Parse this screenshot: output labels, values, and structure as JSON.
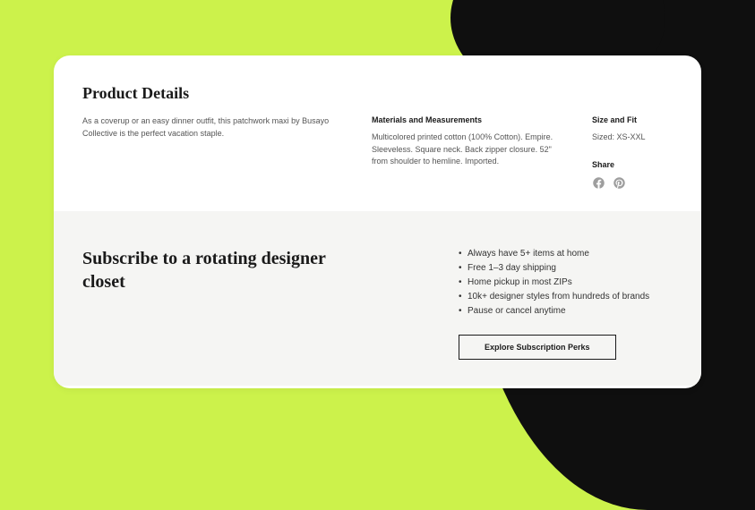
{
  "productDetails": {
    "heading": "Product Details",
    "description": "As a coverup or an easy dinner outfit, this patchwork maxi by Busayo Collective is the perfect vacation staple.",
    "materials": {
      "heading": "Materials and Measurements",
      "text": "Multicolored printed cotton (100% Cotton). Empire. Sleeveless. Square neck. Back zipper closure. 52\" from shoulder to hemline. Imported."
    },
    "sizeFit": {
      "heading": "Size and Fit",
      "text": "Sized: XS-XXL"
    },
    "share": {
      "heading": "Share"
    }
  },
  "subscribe": {
    "heading": "Subscribe to a rotating designer closet",
    "perks": [
      "Always have 5+ items at home",
      "Free 1–3 day shipping",
      "Home pickup in most ZIPs",
      "10k+ designer styles from hundreds of brands",
      "Pause or cancel anytime"
    ],
    "cta": "Explore Subscription Perks"
  }
}
